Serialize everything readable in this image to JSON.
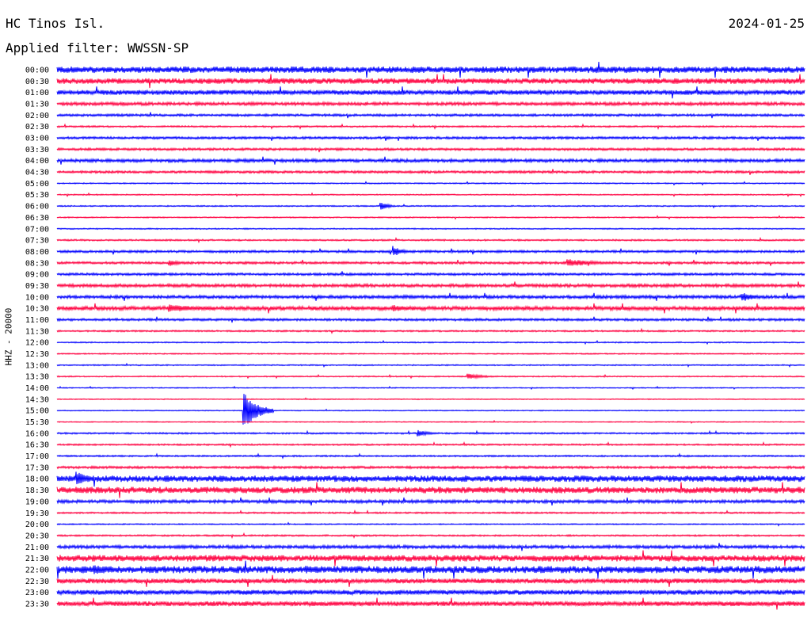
{
  "header": {
    "station": "HC Tinos Isl.",
    "date": "2024-01-25",
    "filter": "Applied filter: WWSSN-SP"
  },
  "chart_data": {
    "type": "line",
    "title": "HC Tinos Isl.",
    "date": "2024-01-25",
    "filter": "Applied filter: WWSSN-SP",
    "ylabel": "HHZ - 20000",
    "colors": [
      "#0000ff",
      "#ff0040"
    ],
    "grid": false,
    "rows": [
      {
        "label": "00:00",
        "color": "#0000ff",
        "amplitude": 8
      },
      {
        "label": "00:30",
        "color": "#ff0040",
        "amplitude": 7
      },
      {
        "label": "01:00",
        "color": "#0000ff",
        "amplitude": 6
      },
      {
        "label": "01:30",
        "color": "#ff0040",
        "amplitude": 4
      },
      {
        "label": "02:00",
        "color": "#0000ff",
        "amplitude": 3
      },
      {
        "label": "02:30",
        "color": "#ff0040",
        "amplitude": 2
      },
      {
        "label": "03:00",
        "color": "#0000ff",
        "amplitude": 3
      },
      {
        "label": "03:30",
        "color": "#ff0040",
        "amplitude": 3
      },
      {
        "label": "04:00",
        "color": "#0000ff",
        "amplitude": 4
      },
      {
        "label": "04:30",
        "color": "#ff0040",
        "amplitude": 3
      },
      {
        "label": "05:00",
        "color": "#0000ff",
        "amplitude": 1.5
      },
      {
        "label": "05:30",
        "color": "#ff0040",
        "amplitude": 1.5
      },
      {
        "label": "06:00",
        "color": "#0000ff",
        "amplitude": 1.5
      },
      {
        "label": "06:30",
        "color": "#ff0040",
        "amplitude": 1.5
      },
      {
        "label": "07:00",
        "color": "#0000ff",
        "amplitude": 1.5
      },
      {
        "label": "07:30",
        "color": "#ff0040",
        "amplitude": 2
      },
      {
        "label": "08:00",
        "color": "#0000ff",
        "amplitude": 3
      },
      {
        "label": "08:30",
        "color": "#ff0040",
        "amplitude": 3
      },
      {
        "label": "09:00",
        "color": "#0000ff",
        "amplitude": 3
      },
      {
        "label": "09:30",
        "color": "#ff0040",
        "amplitude": 4
      },
      {
        "label": "10:00",
        "color": "#0000ff",
        "amplitude": 4
      },
      {
        "label": "10:30",
        "color": "#ff0040",
        "amplitude": 5
      },
      {
        "label": "11:00",
        "color": "#0000ff",
        "amplitude": 3
      },
      {
        "label": "11:30",
        "color": "#ff0040",
        "amplitude": 2
      },
      {
        "label": "12:00",
        "color": "#0000ff",
        "amplitude": 1.5
      },
      {
        "label": "12:30",
        "color": "#ff0040",
        "amplitude": 1.5
      },
      {
        "label": "13:00",
        "color": "#0000ff",
        "amplitude": 1.5
      },
      {
        "label": "13:30",
        "color": "#ff0040",
        "amplitude": 1.5
      },
      {
        "label": "14:00",
        "color": "#0000ff",
        "amplitude": 1.2
      },
      {
        "label": "14:30",
        "color": "#ff0040",
        "amplitude": 1.2
      },
      {
        "label": "15:00",
        "color": "#0000ff",
        "amplitude": 1.2
      },
      {
        "label": "15:30",
        "color": "#ff0040",
        "amplitude": 1.2
      },
      {
        "label": "16:00",
        "color": "#0000ff",
        "amplitude": 2
      },
      {
        "label": "16:30",
        "color": "#ff0040",
        "amplitude": 2
      },
      {
        "label": "17:00",
        "color": "#0000ff",
        "amplitude": 2
      },
      {
        "label": "17:30",
        "color": "#ff0040",
        "amplitude": 3
      },
      {
        "label": "18:00",
        "color": "#0000ff",
        "amplitude": 8
      },
      {
        "label": "18:30",
        "color": "#ff0040",
        "amplitude": 8
      },
      {
        "label": "19:00",
        "color": "#0000ff",
        "amplitude": 4
      },
      {
        "label": "19:30",
        "color": "#ff0040",
        "amplitude": 2
      },
      {
        "label": "20:00",
        "color": "#0000ff",
        "amplitude": 1.5
      },
      {
        "label": "20:30",
        "color": "#ff0040",
        "amplitude": 2
      },
      {
        "label": "21:00",
        "color": "#0000ff",
        "amplitude": 4
      },
      {
        "label": "21:30",
        "color": "#ff0040",
        "amplitude": 8
      },
      {
        "label": "22:00",
        "color": "#0000ff",
        "amplitude": 9
      },
      {
        "label": "22:30",
        "color": "#ff0040",
        "amplitude": 6
      },
      {
        "label": "23:00",
        "color": "#0000ff",
        "amplitude": 6
      },
      {
        "label": "23:30",
        "color": "#ff0040",
        "amplitude": 6
      }
    ],
    "events": [
      {
        "row": "06:00",
        "time_min": 13.0,
        "amplitude": 12,
        "duration_min": 0.6
      },
      {
        "row": "08:00",
        "time_min": 13.5,
        "amplitude": 14,
        "duration_min": 0.8
      },
      {
        "row": "08:30",
        "time_min": 4.5,
        "amplitude": 8,
        "duration_min": 1.0
      },
      {
        "row": "08:30",
        "time_min": 20.5,
        "amplitude": 10,
        "duration_min": 2.5
      },
      {
        "row": "10:00",
        "time_min": 27.5,
        "amplitude": 12,
        "duration_min": 1.2
      },
      {
        "row": "10:30",
        "time_min": 4.5,
        "amplitude": 10,
        "duration_min": 3.0
      },
      {
        "row": "10:30",
        "time_min": 13.5,
        "amplitude": 9,
        "duration_min": 1.5
      },
      {
        "row": "13:30",
        "time_min": 16.5,
        "amplitude": 7,
        "duration_min": 1.5
      },
      {
        "row": "15:00",
        "time_min": 7.5,
        "amplitude": 45,
        "duration_min": 1.2
      },
      {
        "row": "16:00",
        "time_min": 14.5,
        "amplitude": 8,
        "duration_min": 1.0
      },
      {
        "row": "18:00",
        "time_min": 0.8,
        "amplitude": 18,
        "duration_min": 1.2
      },
      {
        "row": "22:00",
        "time_min": 1.5,
        "amplitude": 12,
        "duration_min": 2.0
      },
      {
        "row": "22:00",
        "time_min": 10.0,
        "amplitude": 10,
        "duration_min": 2.0
      }
    ]
  }
}
